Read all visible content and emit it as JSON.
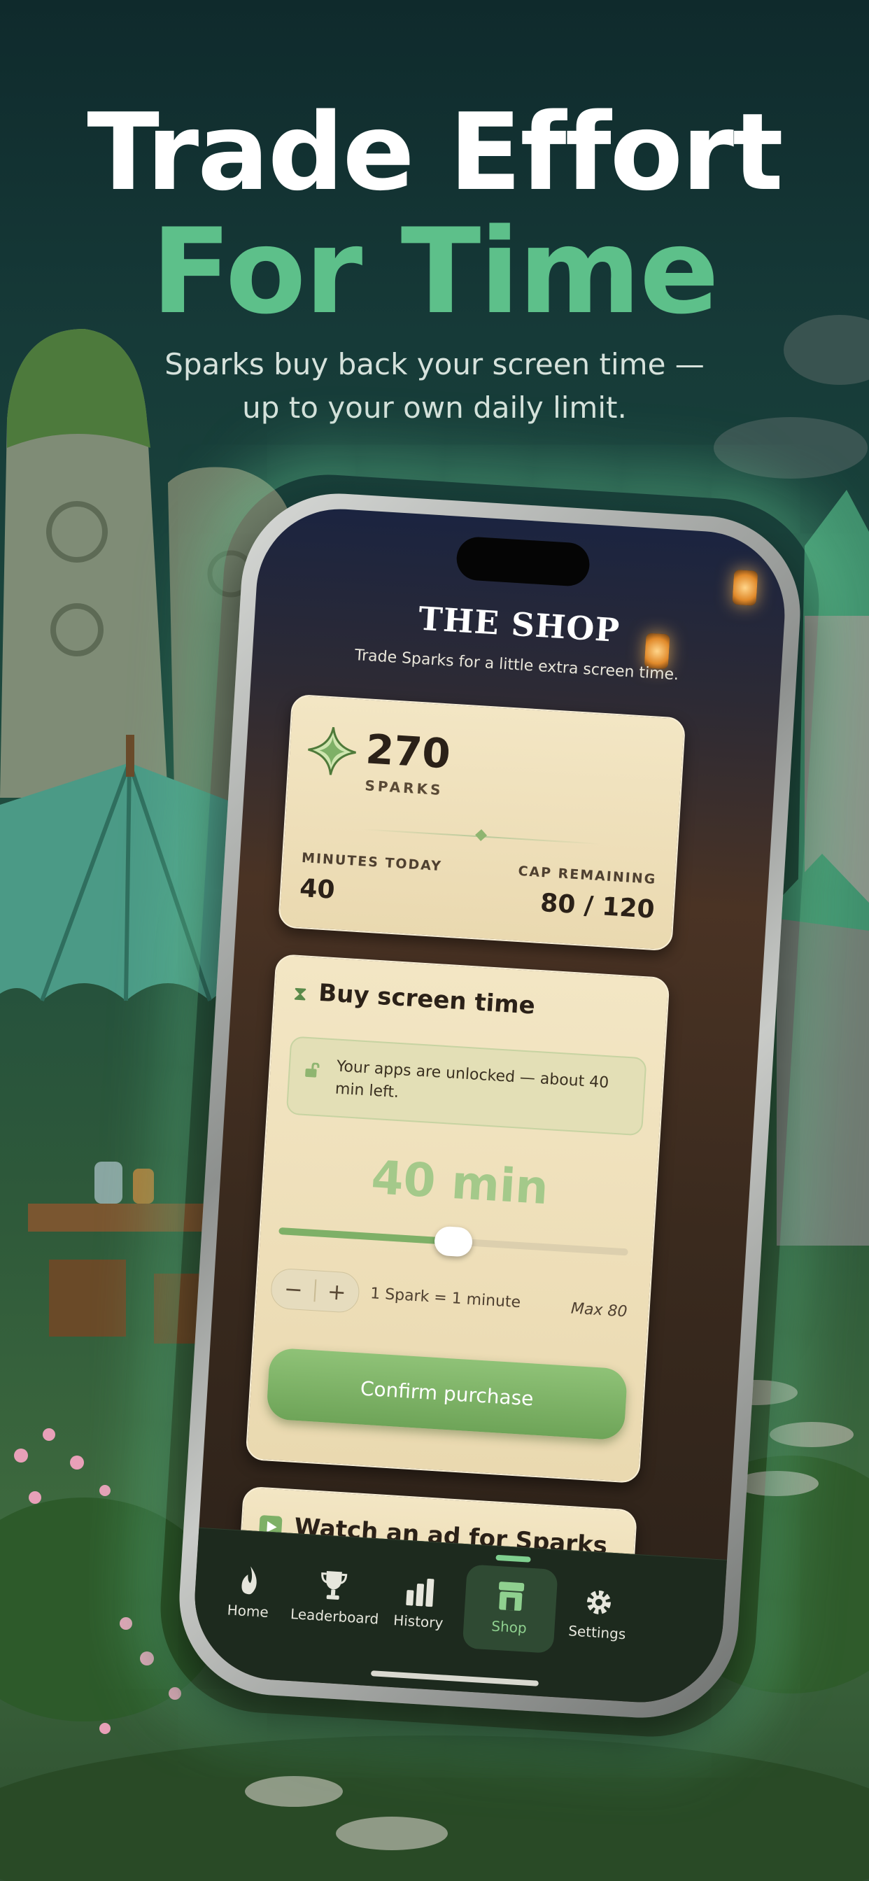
{
  "headline": {
    "line1": "Trade Effort",
    "line2": "For Time",
    "subtitle_line1": "Sparks buy back your screen time —",
    "subtitle_line2": "up to your own daily limit."
  },
  "colors": {
    "accent_green": "#5dc08a",
    "button_green": "#7eb067",
    "card_bg": "#f3e6c4"
  },
  "shop": {
    "title": "THE SHOP",
    "subtitle": "Trade Sparks for a little extra screen time."
  },
  "balance": {
    "sparks": "270",
    "sparks_label": "SPARKS",
    "icon": "spark-star-icon",
    "minutes_today_label": "MINUTES TODAY",
    "minutes_today": "40",
    "cap_remaining_label": "CAP REMAINING",
    "cap_remaining": "80 / 120"
  },
  "buy": {
    "title": "Buy screen time",
    "icon": "hourglass-icon",
    "notice": "Your apps are unlocked — about 40 min left.",
    "notice_icon": "unlock-icon",
    "selected_amount": "40 min",
    "slider_value": 40,
    "slider_max": 80,
    "minus": "−",
    "plus": "+",
    "rate": "1 Spark = 1 minute",
    "max": "Max 80",
    "confirm": "Confirm purchase"
  },
  "ad": {
    "title": "Watch an ad for Sparks",
    "icon": "play-icon"
  },
  "tabs": [
    {
      "label": "Home",
      "icon": "flame-icon"
    },
    {
      "label": "Leaderboard",
      "icon": "trophy-icon"
    },
    {
      "label": "History",
      "icon": "bar-chart-icon"
    },
    {
      "label": "Shop",
      "icon": "shop-icon",
      "active": true
    },
    {
      "label": "Settings",
      "icon": "gear-icon"
    }
  ]
}
